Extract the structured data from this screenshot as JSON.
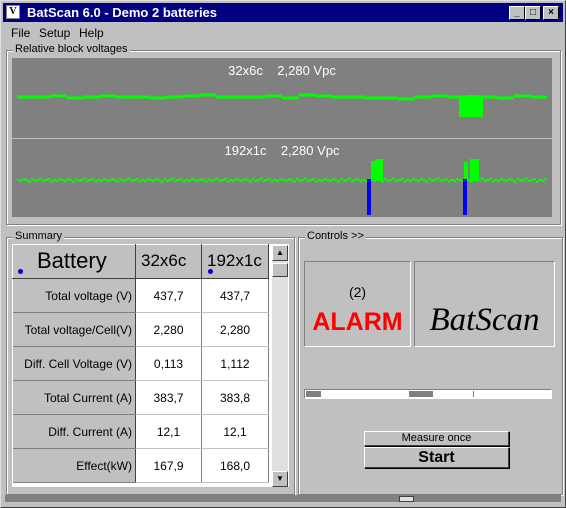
{
  "window": {
    "title": "BatScan 6.0 - Demo  2 batteries",
    "app_icon": "V"
  },
  "titlebar_buttons": {
    "minimize": "_",
    "maximize": "□",
    "close": "×"
  },
  "menu": [
    "File",
    "Setup",
    "Help"
  ],
  "voltages_group": {
    "label": "Relative block voltages",
    "panels": [
      {
        "caption": "32x6c    2,280 Vpc",
        "trace_color": "#00ff00"
      },
      {
        "caption": "192x1c    2,280 Vpc",
        "trace_color": "#00ff00",
        "marker_color": "#0000ff"
      }
    ]
  },
  "summary": {
    "label": "Summary",
    "header": {
      "corner": "Battery",
      "columns": [
        "32x6c",
        "192x1c"
      ]
    },
    "rows": [
      {
        "label": "Total voltage (V)",
        "values": [
          "437,7",
          "437,7"
        ]
      },
      {
        "label": "Total voltage/Cell(V)",
        "values": [
          "2,280",
          "2,280"
        ]
      },
      {
        "label": "Diff. Cell Voltage (V)",
        "values": [
          "0,113",
          "1,112"
        ]
      },
      {
        "label": "Total Current (A)",
        "values": [
          "383,7",
          "383,8"
        ]
      },
      {
        "label": "Diff. Current (A)",
        "values": [
          "12,1",
          "12,1"
        ]
      },
      {
        "label": "Effect(kW)",
        "values": [
          "167,9",
          "168,0"
        ]
      }
    ]
  },
  "controls": {
    "label": "Controls >>",
    "alarm_count": "(2)",
    "alarm_text": "ALARM",
    "alarm_color": "#ff0000",
    "logo_text": "BatScan",
    "measure_once_label": "Measure once",
    "start_label": "Start"
  },
  "icons": {
    "scroll_up": "up-arrow-icon",
    "scroll_down": "down-arrow-icon"
  }
}
